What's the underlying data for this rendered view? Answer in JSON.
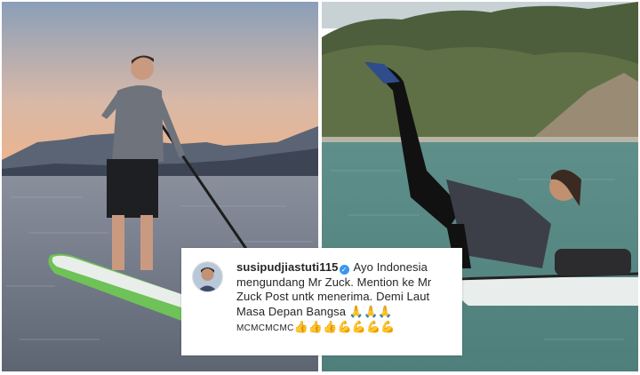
{
  "collage": {
    "left_photo": {
      "subject": "man-standing-on-paddleboard-at-sunset"
    },
    "right_photo": {
      "subject": "woman-doing-leg-raise-on-paddleboard"
    }
  },
  "comment": {
    "username": "susipudjiastuti115",
    "verified_icon": "verified-check-icon",
    "text": "Ayo Indonesia mengundang Mr Zuck. Mention ke Mr Zuck Post untk menerima. Demi Laut Masa Depan Bangsa",
    "pray_emojis": "🙏🙏🙏",
    "tail_text": "MCMCMCMC",
    "tail_emojis": "👍👍👍💪💪💪💪"
  },
  "colors": {
    "verified_badge": "#3897f0",
    "text": "#262626",
    "board_green": "#6ec257"
  }
}
